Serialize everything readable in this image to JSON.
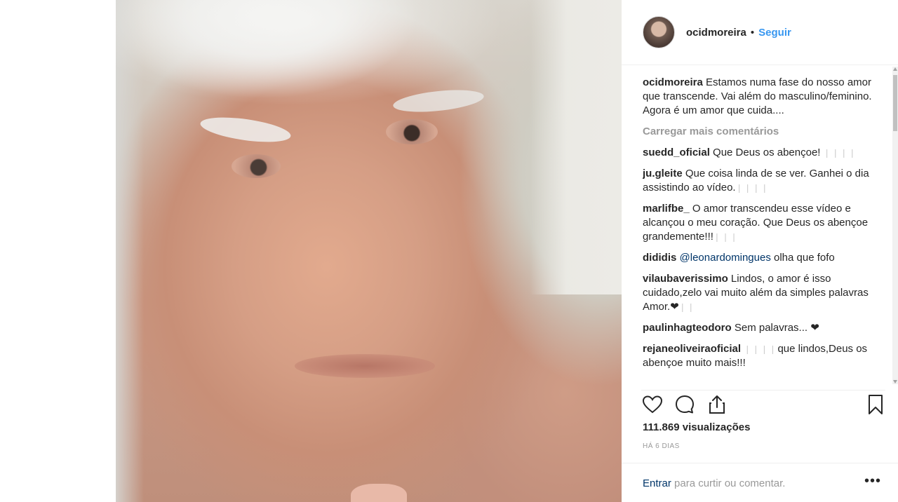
{
  "post": {
    "author": "ocidmoreira",
    "follow_label": "Seguir",
    "separator": "•",
    "caption": "Estamos numa fase do nosso amor que transcende. Vai além do masculino/feminino. Agora é um amor que cuida....",
    "load_more": "Carregar mais comentários",
    "views": "111.869 visualizações",
    "time_ago": "HÁ 6 DIAS"
  },
  "comments": [
    {
      "user": "suedd_oficial",
      "text": "Que Deus os abençoe! ",
      "faint": "❘❘❘❘"
    },
    {
      "user": "ju.gleite",
      "text": "Que coisa linda de se ver. Ganhei o dia assistindo ao vídeo.",
      "faint": "❘❘❘❘"
    },
    {
      "user": "marlifbe_",
      "text": "O amor transcendeu esse vídeo e alcançou o meu coração. Que Deus os abençoe grandemente!!!",
      "faint": "❘❘❘"
    },
    {
      "user": "dididis",
      "mention": "@leonardomingues",
      "text": " olha que fofo"
    },
    {
      "user": "vilaubaverissimo",
      "text": "Lindos, o amor é isso cuidado,zelo vai muito além da simples palavras Amor.❤",
      "faint": "❘❘"
    },
    {
      "user": "paulinhagteodoro",
      "text": "Sem palavras... ❤"
    },
    {
      "user": "rejaneoliveiraoficial",
      "faint": "❘❘❘❘",
      "text": "que lindos,Deus os abençoe muito mais!!!"
    }
  ],
  "actions": {
    "like": "heart-icon",
    "comment": "comment-icon",
    "share": "share-icon",
    "save": "bookmark-icon"
  },
  "footer": {
    "login_link": "Entrar",
    "login_text": " para curtir ou comentar.",
    "more_icon": "more-options-icon"
  }
}
